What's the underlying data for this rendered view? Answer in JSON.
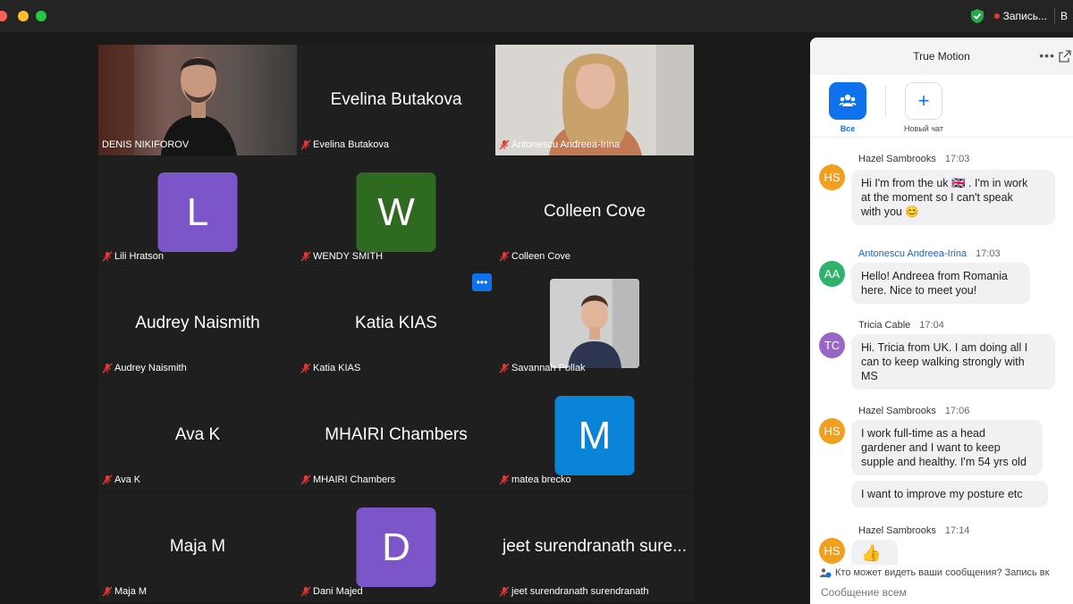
{
  "window": {
    "recording_label": "Запись...",
    "right_cut_label": "В"
  },
  "gallery": {
    "more_label": "•••",
    "tiles": [
      {
        "name": "DENIS NIKIFOROV"
      },
      {
        "name": "Evelina Butakova",
        "display": "Evelina Butakova"
      },
      {
        "name": "Antonescu Andreea-Irina"
      },
      {
        "name": "Lili Hratson",
        "initial": "L"
      },
      {
        "name": "WENDY SMITH",
        "initial": "W"
      },
      {
        "name": "Colleen Cove",
        "display": "Colleen Cove"
      },
      {
        "name": "Audrey Naismith",
        "display": "Audrey Naismith"
      },
      {
        "name": "Katia KIAS",
        "display": "Katia KIAS"
      },
      {
        "name": "Savannah Pollak"
      },
      {
        "name": "Ava K",
        "display": "Ava K"
      },
      {
        "name": "MHAIRI Chambers",
        "display": "MHAIRI Chambers"
      },
      {
        "name": "matea brecko",
        "initial": "M"
      },
      {
        "name": "Maja M",
        "display": "Maja M"
      },
      {
        "name": "Dani Majed",
        "initial": "D"
      },
      {
        "name": "jeet surendranath surendranath",
        "display": "jeet surendranath sure..."
      }
    ],
    "colors": {
      "avatar_purple": "#7c55c9",
      "avatar_green": "#2e6a1f",
      "avatar_blue": "#0a84d6",
      "active_border": "#4caf50"
    }
  },
  "chat": {
    "title": "True Motion",
    "dots": "•••",
    "tab_all": "Все",
    "tab_new": "Новый чат",
    "new_plus": "+",
    "messages": [
      {
        "initials": "HS",
        "sender": "Hazel Sambrooks",
        "time": "17:03",
        "lines": [
          "Hi I'm from the uk 🇬🇧 .  I'm in work",
          "at the moment so I can't speak",
          "with you 😊"
        ]
      },
      {
        "initials": "AA",
        "sender": "Antonescu Andreea-Irina",
        "time": "17:03",
        "lines": [
          "Hello! Andreea from Romania",
          "here. Nice to meet you!"
        ]
      },
      {
        "initials": "TC",
        "sender": "Tricia Cable",
        "time": "17:04",
        "lines": [
          "Hi. Tricia from UK. I am doing all I",
          "can to keep walking  strongly with",
          "MS"
        ]
      },
      {
        "initials": "HS",
        "sender": "Hazel Sambrooks",
        "time": "17:06",
        "lines": [
          "I work full-time as a head",
          "gardener and I want to keep",
          "supple and healthy. I'm 54 yrs old"
        ],
        "extra": "I want to improve my posture etc"
      },
      {
        "initials": "HS",
        "sender": "Hazel Sambrooks",
        "time": "17:14",
        "lines": [
          "👍"
        ]
      }
    ],
    "notice": "Кто может видеть ваши сообщения? Запись вк",
    "compose_placeholder": "Сообщение всем"
  }
}
